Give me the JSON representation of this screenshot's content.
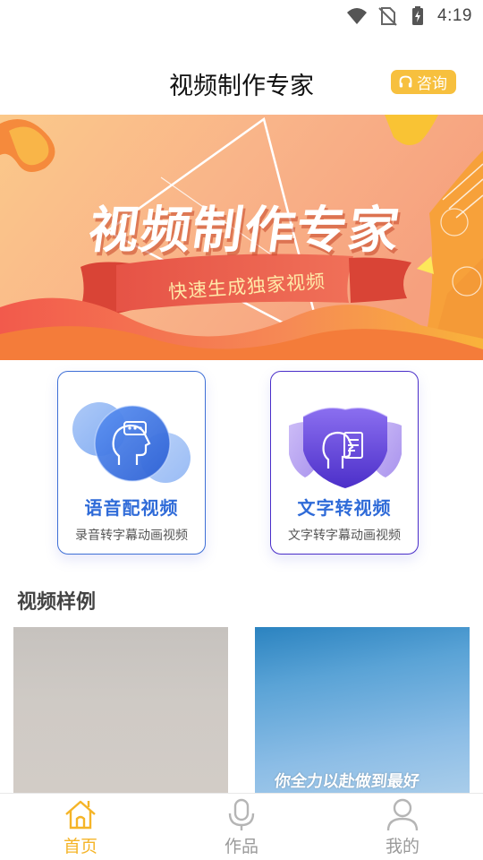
{
  "status_bar": {
    "time": "4:19"
  },
  "header": {
    "title": "视频制作专家",
    "consult_label": "咨询"
  },
  "banner": {
    "title": "视频制作专家",
    "subtitle": "快速生成独家视频"
  },
  "features": [
    {
      "title": "语音配视频",
      "desc": "录音转字幕动画视频"
    },
    {
      "title": "文字转视频",
      "desc": "文字转字幕动画视频"
    }
  ],
  "samples": {
    "section_title": "视频样例",
    "items": [
      {
        "caption": ""
      },
      {
        "caption": "你全力以赴做到最好",
        "caption2": ""
      }
    ]
  },
  "bottom_nav": [
    {
      "label": "首页",
      "active": true
    },
    {
      "label": "作品",
      "active": false
    },
    {
      "label": "我的",
      "active": false
    }
  ],
  "colors": {
    "accent": "#f5b427",
    "voice_blue": "#2f6bd8",
    "text_purple": "#4a2fc9"
  }
}
